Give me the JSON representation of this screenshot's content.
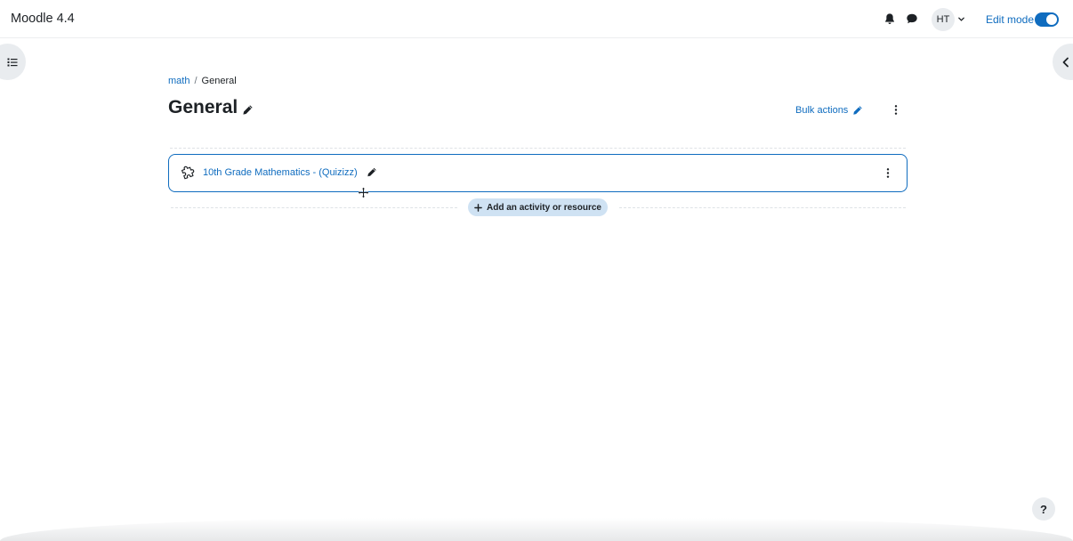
{
  "navbar": {
    "brand": "Moodle 4.4",
    "user_initials": "HT",
    "edit_mode_label": "Edit mode",
    "edit_mode_on": true
  },
  "breadcrumb": {
    "parent": "math",
    "separator": "/",
    "current": "General"
  },
  "page": {
    "title": "General",
    "bulk_actions_label": "Bulk actions"
  },
  "activity": {
    "name": "10th Grade Mathematics - (Quizizz)",
    "icon": "puzzle-piece-icon"
  },
  "add_activity_label": "Add an activity or resource",
  "help_label": "?",
  "colors": {
    "accent": "#0f6cbf",
    "add_button_bg": "#cfe2f3",
    "neutral_bg": "#e9ecef"
  }
}
